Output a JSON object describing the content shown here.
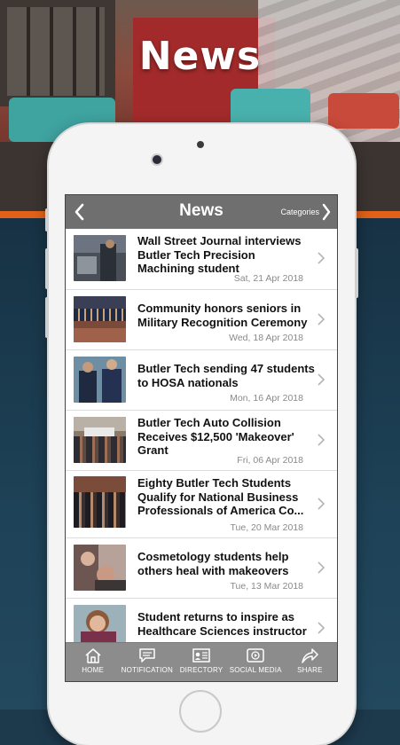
{
  "hero": {
    "title": "News"
  },
  "navbar": {
    "title": "News",
    "categories_label": "Categories"
  },
  "news": [
    {
      "title": "Wall Street Journal interviews Butler Tech Precision Machining student",
      "date": "Sat, 21 Apr 2018"
    },
    {
      "title": "Community honors seniors in Military Recognition Ceremony",
      "date": "Wed, 18 Apr 2018"
    },
    {
      "title": "Butler Tech sending 47 students to HOSA nationals",
      "date": "Mon, 16 Apr 2018"
    },
    {
      "title": "Butler Tech Auto Collision Receives $12,500 'Makeover' Grant",
      "date": "Fri, 06 Apr 2018"
    },
    {
      "title": "Eighty Butler Tech Students Qualify for National Business Professionals of America Co...",
      "date": "Tue, 20 Mar 2018"
    },
    {
      "title": "Cosmetology students help others heal with makeovers",
      "date": "Tue, 13 Mar 2018"
    },
    {
      "title": "Student returns to inspire as Healthcare Sciences instructor",
      "date": ""
    }
  ],
  "tabbar": {
    "home": "HOME",
    "notification": "NOTIFICATION",
    "directory": "DIRECTORY",
    "social_media": "SOCIAL MEDIA",
    "share": "SHARE"
  },
  "colors": {
    "navbar": "#6f6f6f",
    "tabbar": "#8c8c8c",
    "accent_orange": "#e2611a",
    "background_blue": "#1d3a4d"
  }
}
